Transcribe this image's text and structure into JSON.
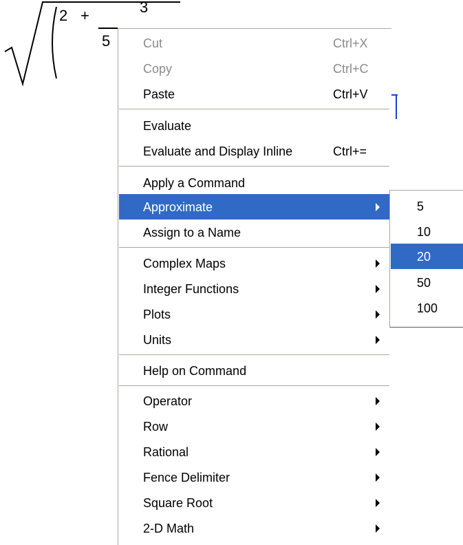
{
  "math": {
    "numerator": "3",
    "two": "2",
    "plus": "+",
    "denominator": "5"
  },
  "context_menu": {
    "cut": {
      "label": "Cut",
      "shortcut": "Ctrl+X"
    },
    "copy": {
      "label": "Copy",
      "shortcut": "Ctrl+C"
    },
    "paste": {
      "label": "Paste",
      "shortcut": "Ctrl+V"
    },
    "evaluate": {
      "label": "Evaluate"
    },
    "evaluate_inline": {
      "label": "Evaluate and Display Inline",
      "shortcut": "Ctrl+="
    },
    "apply_command": {
      "label": "Apply a Command"
    },
    "approximate": {
      "label": "Approximate"
    },
    "assign_name": {
      "label": "Assign to a Name"
    },
    "complex_maps": {
      "label": "Complex Maps"
    },
    "integer_functions": {
      "label": "Integer Functions"
    },
    "plots": {
      "label": "Plots"
    },
    "units": {
      "label": "Units"
    },
    "help_on_command": {
      "label": "Help on Command"
    },
    "operator": {
      "label": "Operator"
    },
    "row": {
      "label": "Row"
    },
    "rational": {
      "label": "Rational"
    },
    "fence_delimiter": {
      "label": "Fence Delimiter"
    },
    "square_root": {
      "label": "Square Root"
    },
    "two_d_math": {
      "label": "2-D Math"
    }
  },
  "approximate_submenu": {
    "items": [
      "5",
      "10",
      "20",
      "50",
      "100"
    ],
    "selected": "20"
  },
  "colors": {
    "highlight": "#316ac5",
    "disabled_text": "#8b8b8b",
    "cursor": "#1a3fcf"
  }
}
